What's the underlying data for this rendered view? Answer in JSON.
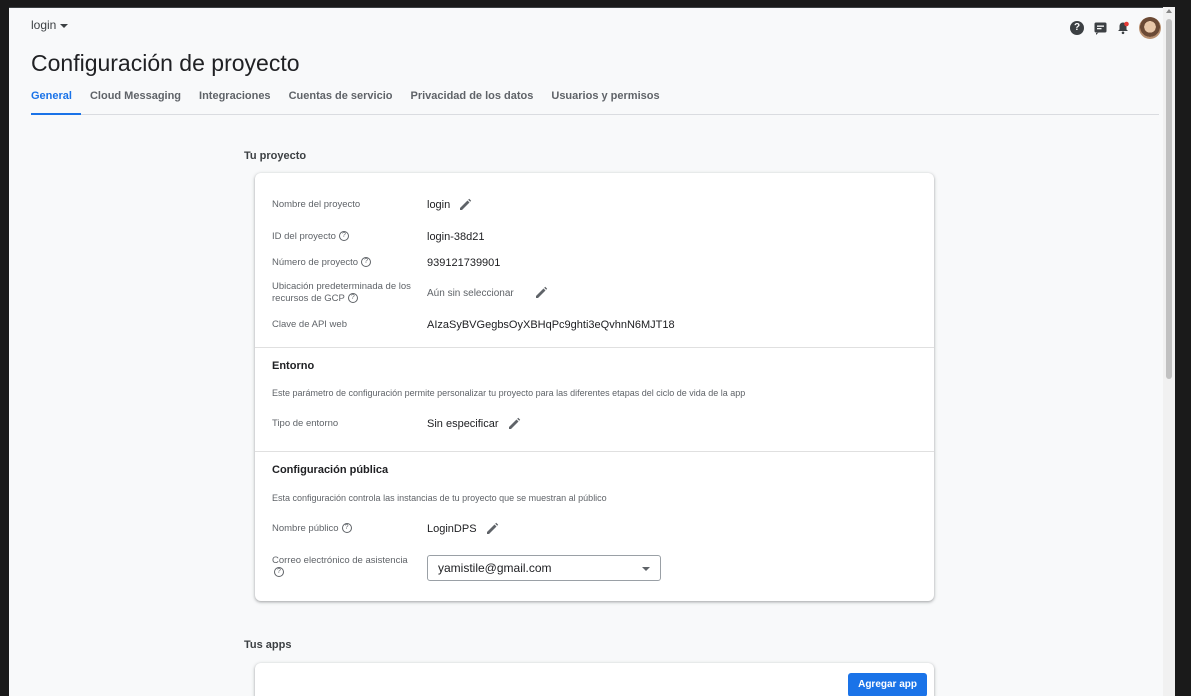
{
  "header": {
    "project_switcher": "login",
    "page_title": "Configuración de proyecto"
  },
  "tabs": [
    {
      "label": "General",
      "active": true
    },
    {
      "label": "Cloud Messaging"
    },
    {
      "label": "Integraciones"
    },
    {
      "label": "Cuentas de servicio"
    },
    {
      "label": "Privacidad de los datos"
    },
    {
      "label": "Usuarios y permisos"
    }
  ],
  "top_icons": [
    "help-icon",
    "feedback-icon",
    "notifications-icon",
    "avatar"
  ],
  "project": {
    "section_title": "Tu proyecto",
    "name_label": "Nombre del proyecto",
    "name_value": "login",
    "id_label": "ID del proyecto",
    "id_value": "login-38d21",
    "number_label": "Número de proyecto",
    "number_value": "939121739901",
    "location_label_1": "Ubicación predeterminada de los",
    "location_label_2": "recursos de GCP",
    "location_value": "Aún sin seleccionar",
    "apikey_label": "Clave de API web",
    "apikey_value": "AIzaSyBVGegbsOyXBHqPc9ghti3eQvhnN6MJT18"
  },
  "environment": {
    "title": "Entorno",
    "description": "Este parámetro de configuración permite personalizar tu proyecto para las diferentes etapas del ciclo de vida de la app",
    "type_label": "Tipo de entorno",
    "type_value": "Sin especificar"
  },
  "public_config": {
    "title": "Configuración pública",
    "description": "Esta configuración controla las instancias de tu proyecto que se muestran al público",
    "public_name_label": "Nombre público",
    "public_name_value": "LoginDPS",
    "support_email_label_1": "Correo electrónico de asistencia",
    "support_email_value": "yamistile@gmail.com"
  },
  "apps": {
    "section_title": "Tus apps",
    "add_button": "Agregar app"
  },
  "colors": {
    "accent": "#1a73e8",
    "background": "#f8f9fa"
  }
}
